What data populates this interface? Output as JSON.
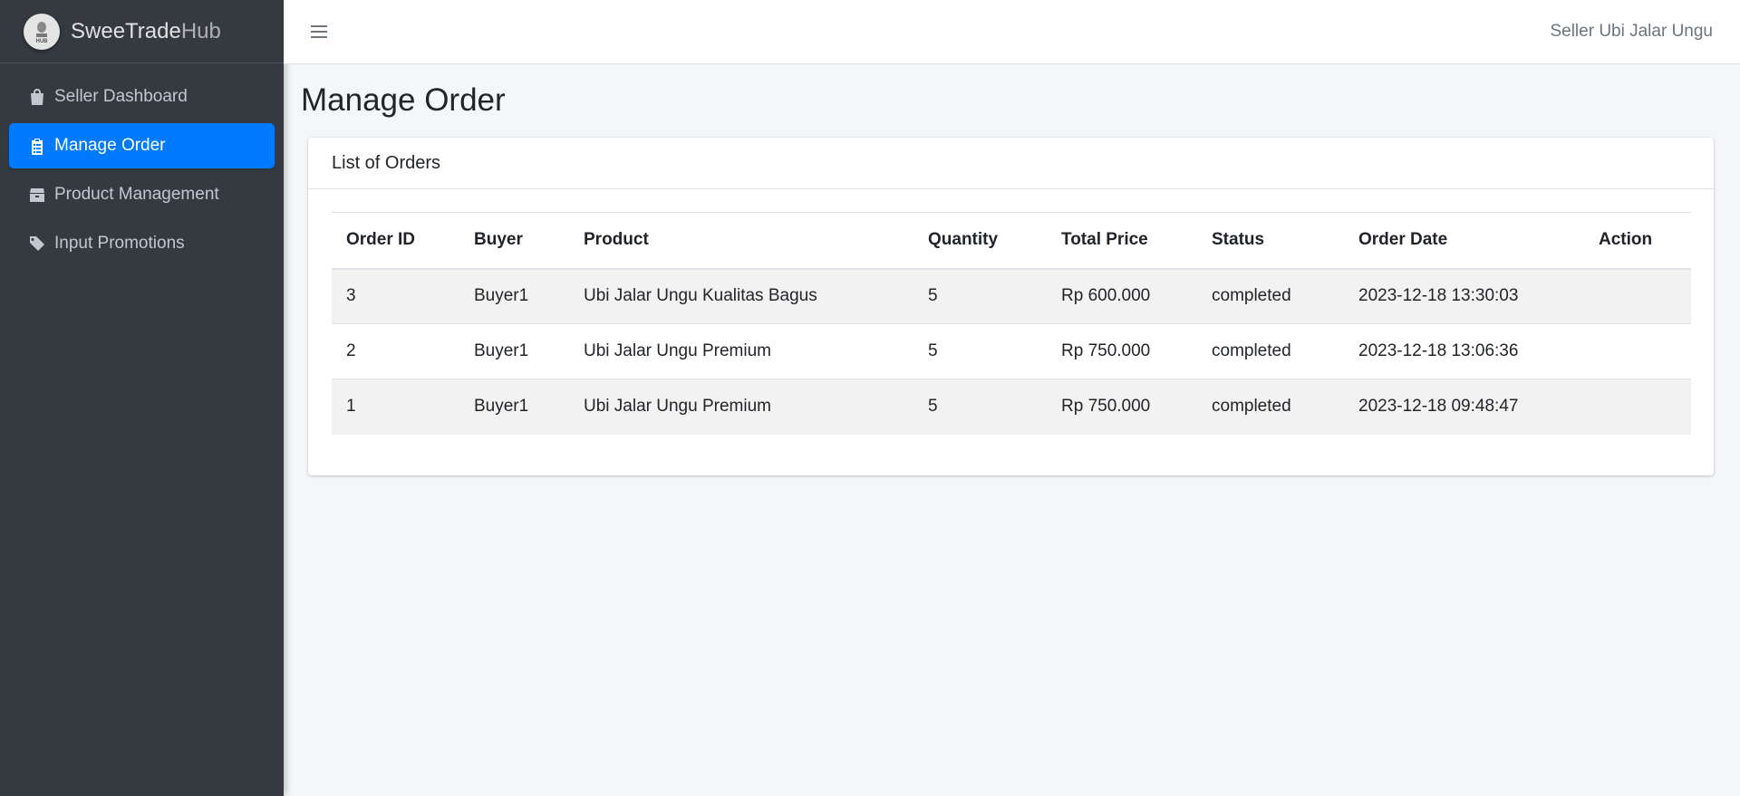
{
  "brand": {
    "name_bold": "SweeTrade",
    "name_light": "Hub",
    "logo_text": "HUB"
  },
  "sidebar": {
    "items": [
      {
        "label": "Seller Dashboard",
        "icon": "shopping-bag-icon",
        "active": false
      },
      {
        "label": "Manage Order",
        "icon": "clipboard-list-icon",
        "active": true
      },
      {
        "label": "Product Management",
        "icon": "box-icon",
        "active": false
      },
      {
        "label": "Input Promotions",
        "icon": "tags-icon",
        "active": false
      }
    ]
  },
  "topbar": {
    "user_name": "Seller Ubi Jalar Ungu",
    "menu_icon": "hamburger-icon"
  },
  "main": {
    "page_title": "Manage Order",
    "card_title": "List of Orders",
    "table": {
      "headers": [
        "Order ID",
        "Buyer",
        "Product",
        "Quantity",
        "Total Price",
        "Status",
        "Order Date",
        "Action"
      ],
      "rows": [
        [
          "3",
          "Buyer1",
          "Ubi Jalar Ungu Kualitas Bagus",
          "5",
          "Rp 600.000",
          "completed",
          "2023-12-18 13:30:03",
          ""
        ],
        [
          "2",
          "Buyer1",
          "Ubi Jalar Ungu Premium",
          "5",
          "Rp 750.000",
          "completed",
          "2023-12-18 13:06:36",
          ""
        ],
        [
          "1",
          "Buyer1",
          "Ubi Jalar Ungu Premium",
          "5",
          "Rp 750.000",
          "completed",
          "2023-12-18 09:48:47",
          ""
        ]
      ]
    }
  },
  "colors": {
    "sidebar_bg": "#343a40",
    "accent": "#007bff",
    "page_bg": "#f4f6f9"
  }
}
